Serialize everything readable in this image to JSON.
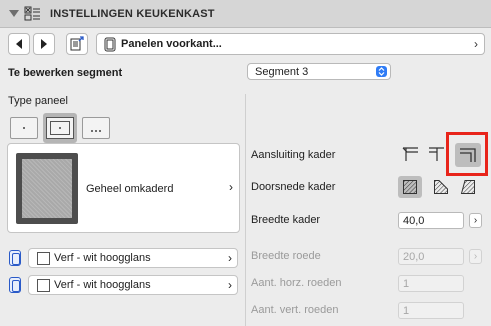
{
  "header": {
    "title": "INSTELLINGEN KEUKENKAST"
  },
  "nav": {
    "field_label": "Panelen voorkant...",
    "chevron": "›"
  },
  "segment": {
    "label": "Te bewerken segment",
    "value": "Segment 3"
  },
  "panel_type": {
    "label": "Type paneel",
    "selected_name": "Geheel omkaderd",
    "chevron": "›"
  },
  "materials": [
    {
      "label": "Verf - wit hoogglans",
      "chevron": "›"
    },
    {
      "label": "Verf - wit hoogglans",
      "chevron": "›"
    }
  ],
  "frame": {
    "connection_label": "Aansluiting kader",
    "section_label": "Doorsnede kader",
    "width_label": "Breedte kader",
    "width_value": "40,0"
  },
  "muntins": {
    "width_label": "Breedte roede",
    "width_value": "20,0",
    "horiz_label": "Aant. horz. roeden",
    "horiz_value": "1",
    "vert_label": "Aant. vert. roeden",
    "vert_value": "1"
  },
  "colors": {
    "highlight": "#e8241a",
    "accent": "#2f7cf6"
  }
}
